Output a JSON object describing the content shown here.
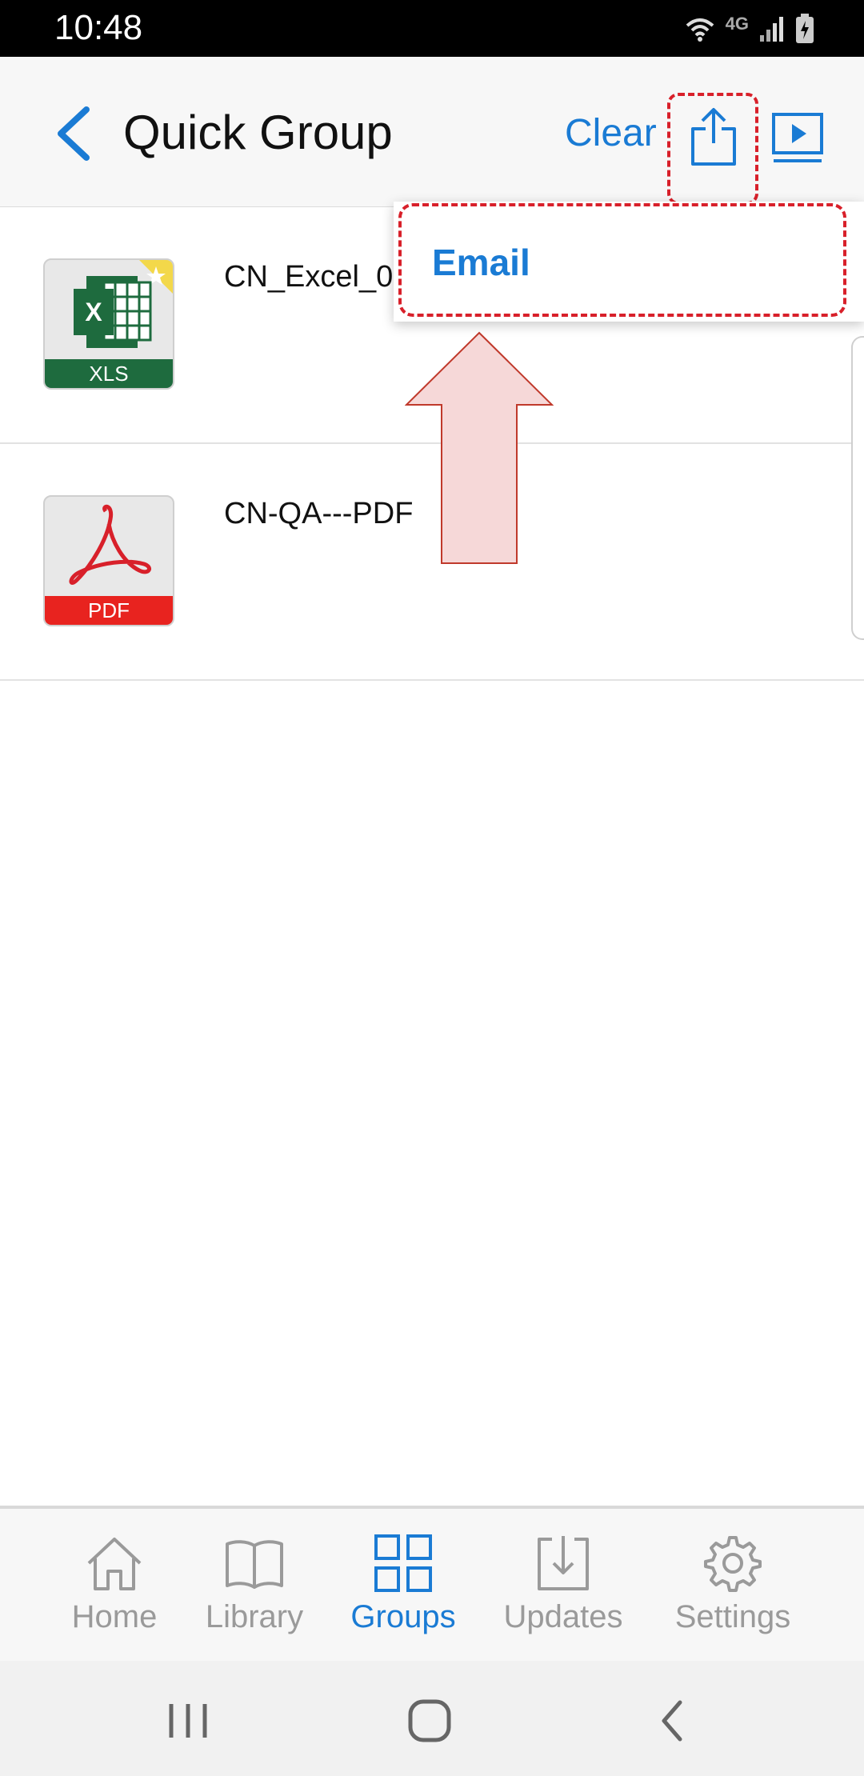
{
  "status_bar": {
    "time": "10:48",
    "network": "4G"
  },
  "header": {
    "title": "Quick Group",
    "clear_label": "Clear"
  },
  "dropdown": {
    "items": [
      {
        "label": "Email"
      }
    ]
  },
  "files": [
    {
      "name": "CN_Excel_0",
      "type_label": "XLS",
      "type": "xls"
    },
    {
      "name": "CN-QA---PDF",
      "type_label": "PDF",
      "type": "pdf"
    }
  ],
  "bottom_nav": {
    "items": [
      {
        "label": "Home",
        "icon": "home-icon"
      },
      {
        "label": "Library",
        "icon": "book-icon"
      },
      {
        "label": "Groups",
        "icon": "grid-icon",
        "active": true
      },
      {
        "label": "Updates",
        "icon": "download-icon"
      },
      {
        "label": "Settings",
        "icon": "gear-icon"
      }
    ]
  },
  "colors": {
    "accent": "#1a7bd4",
    "highlight": "#d8202a",
    "xls_green": "#1e6b3e",
    "pdf_red": "#e8231f"
  }
}
